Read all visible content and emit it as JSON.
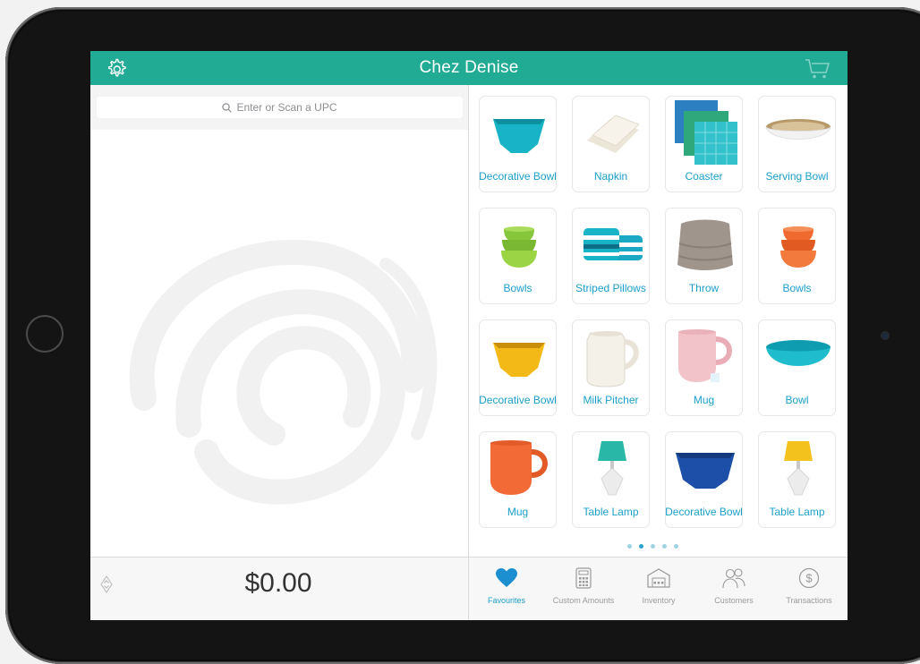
{
  "header": {
    "title": "Chez Denise"
  },
  "search": {
    "placeholder": "Enter or Scan a UPC"
  },
  "order": {
    "total": "$0.00"
  },
  "products": [
    {
      "label": "Decorative Bowl",
      "icon": "teal-hexagon-bowl"
    },
    {
      "label": "Napkin",
      "icon": "folded-napkin"
    },
    {
      "label": "Coaster",
      "icon": "stacked-coasters"
    },
    {
      "label": "Serving Bowl",
      "icon": "white-serving-bowl"
    },
    {
      "label": "Bowls",
      "icon": "green-bowl-stack"
    },
    {
      "label": "Striped Pillows",
      "icon": "striped-pillows"
    },
    {
      "label": "Throw",
      "icon": "knit-throw"
    },
    {
      "label": "Bowls",
      "icon": "orange-bowl-stack"
    },
    {
      "label": "Decorative Bowl",
      "icon": "yellow-hexagon-bowl"
    },
    {
      "label": "Milk Pitcher",
      "icon": "milk-pitcher"
    },
    {
      "label": "Mug",
      "icon": "pink-mug"
    },
    {
      "label": "Bowl",
      "icon": "teal-bowl"
    },
    {
      "label": "Mug",
      "icon": "orange-mug"
    },
    {
      "label": "Table Lamp",
      "icon": "teal-table-lamp"
    },
    {
      "label": "Decorative Bowl",
      "icon": "blue-hexagon-bowl"
    },
    {
      "label": "Table Lamp",
      "icon": "yellow-table-lamp"
    }
  ],
  "pagination": {
    "pages": 5,
    "current": 2
  },
  "tabs": [
    {
      "label": "Favourites",
      "icon": "heart-icon",
      "active": true
    },
    {
      "label": "Custom Amounts",
      "icon": "calculator-icon",
      "active": false
    },
    {
      "label": "Inventory",
      "icon": "warehouse-icon",
      "active": false
    },
    {
      "label": "Customers",
      "icon": "people-icon",
      "active": false
    },
    {
      "label": "Transactions",
      "icon": "dollar-circle-icon",
      "active": false
    }
  ],
  "colors": {
    "brand": "#21ab94",
    "link": "#1b9fc9",
    "tab_inactive": "#9a9a9a"
  }
}
